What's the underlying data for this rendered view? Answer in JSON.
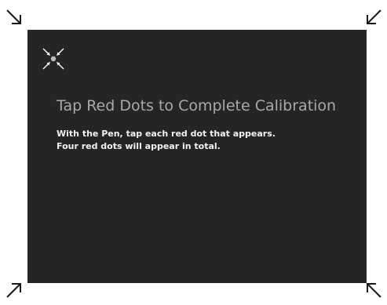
{
  "calibration": {
    "title": "Tap Red Dots to Complete Calibration",
    "instructions": [
      "With the Pen, tap each red dot that appears.",
      "Four red dots will appear in total."
    ]
  },
  "icons": {
    "corner_top_left": "arrow-down-right-icon",
    "corner_top_right": "arrow-down-left-icon",
    "corner_bottom_left": "arrow-up-right-icon",
    "corner_bottom_right": "arrow-up-left-icon",
    "target": "calibration-target-icon"
  },
  "colors": {
    "panel_background": "#252525",
    "page_background": "#ffffff",
    "title_text": "#a9a9a9",
    "instruction_text": "#f2f2f2",
    "target_dot": "#bdbdbd",
    "corner_arrows": "#1a1a1a"
  }
}
